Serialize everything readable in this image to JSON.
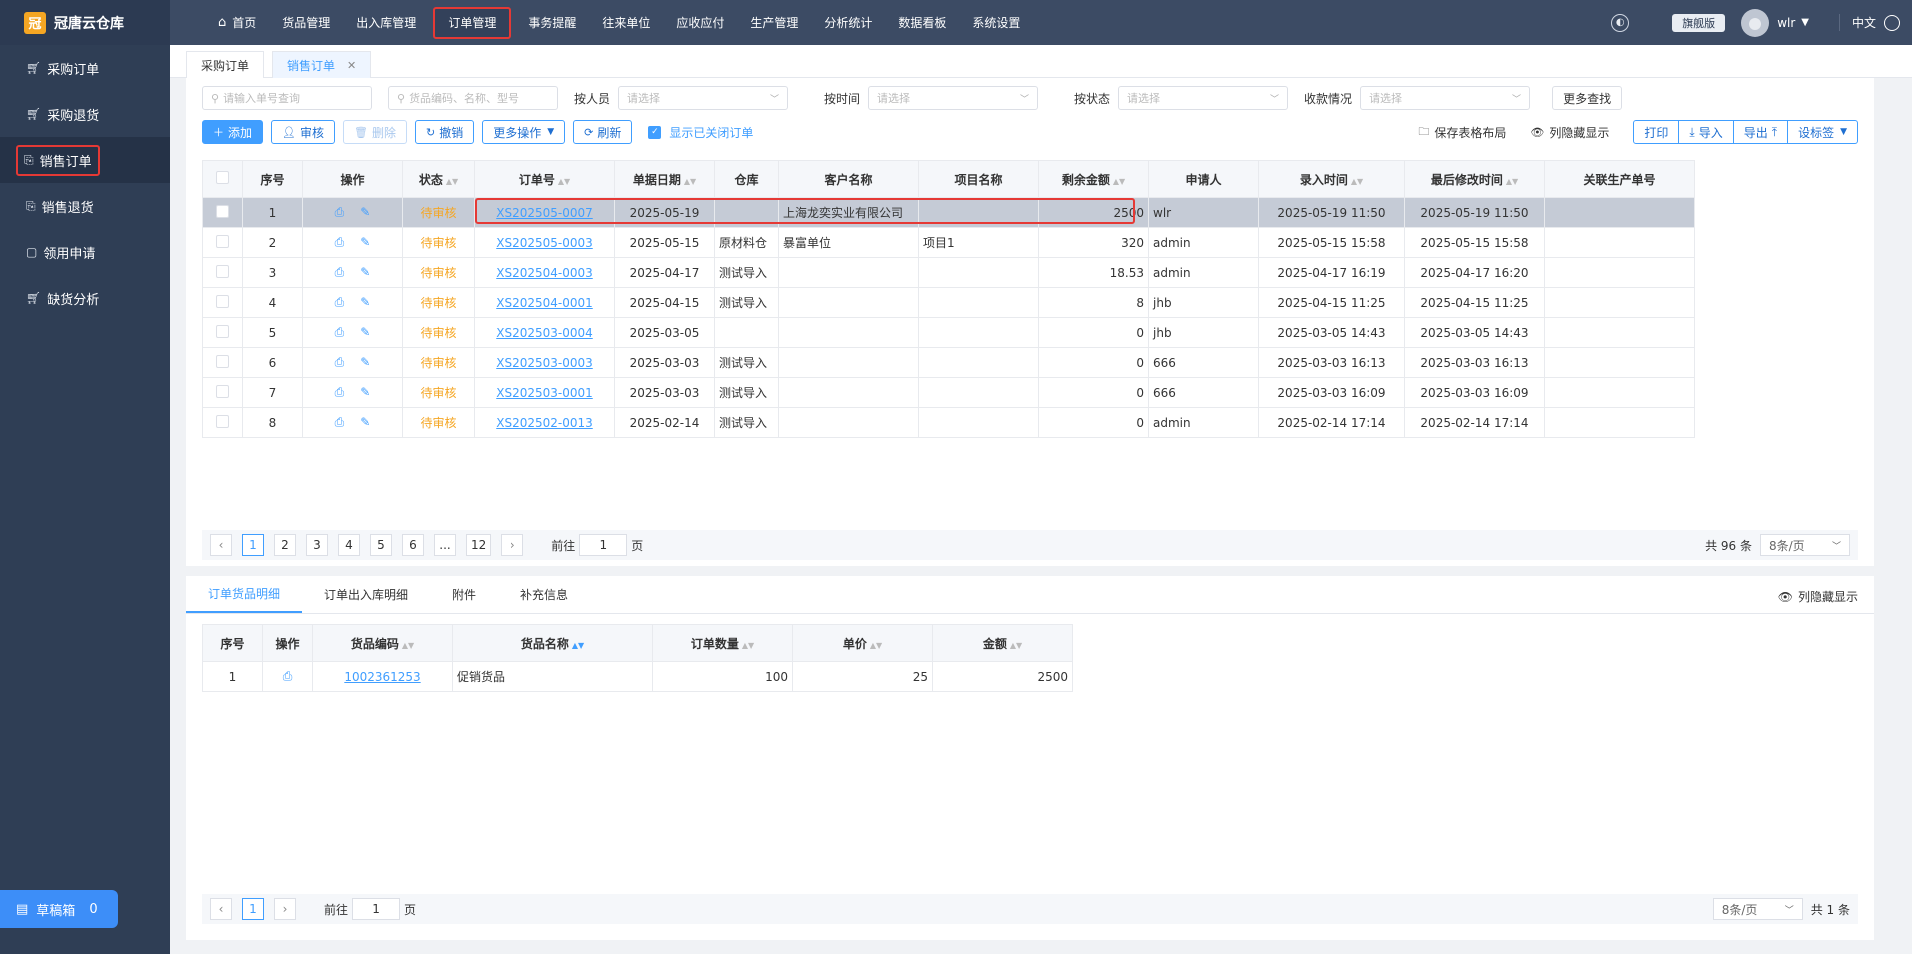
{
  "app": {
    "title": "冠唐云仓库",
    "logo_char": "冠"
  },
  "topnav": [
    {
      "label": "首页",
      "icon": "home-icon"
    },
    {
      "label": "货品管理"
    },
    {
      "label": "出入库管理"
    },
    {
      "label": "订单管理",
      "active": true
    },
    {
      "label": "事务提醒"
    },
    {
      "label": "往来单位"
    },
    {
      "label": "应收应付"
    },
    {
      "label": "生产管理"
    },
    {
      "label": "分析统计"
    },
    {
      "label": "数据看板"
    },
    {
      "label": "系统设置"
    }
  ],
  "topright": {
    "edition": "旗舰版",
    "user": "wlr",
    "lang": "中文"
  },
  "sidebar": [
    {
      "label": "采购订单",
      "icon": "cart-icon"
    },
    {
      "label": "采购退货",
      "icon": "cart-icon"
    },
    {
      "label": "销售订单",
      "icon": "bag-icon",
      "active": true
    },
    {
      "label": "销售退货",
      "icon": "bag-icon"
    },
    {
      "label": "领用申请",
      "icon": "briefcase-icon"
    },
    {
      "label": "缺货分析",
      "icon": "cart-icon"
    }
  ],
  "draft": {
    "label": "草稿箱",
    "count": "0"
  },
  "tabs": [
    {
      "label": "采购订单"
    },
    {
      "label": "销售订单",
      "active": true
    }
  ],
  "filters": {
    "order_search_placeholder": "请输入单号查询",
    "goods_search_placeholder": "货品编码、名称、型号",
    "by_person_label": "按人员",
    "by_time_label": "按时间",
    "by_status_label": "按状态",
    "payment_label": "收款情况",
    "select_placeholder": "请选择",
    "more_find": "更多查找"
  },
  "toolbar": {
    "add": "添加",
    "approve": "审核",
    "delete": "删除",
    "revoke": "撤销",
    "more_ops": "更多操作",
    "refresh": "刷新",
    "show_closed": "显示已关闭订单",
    "save_layout": "保存表格布局",
    "hide_columns": "列隐藏显示",
    "print": "打印",
    "import": "导入",
    "export": "导出",
    "set_tag": "设标签"
  },
  "orders": {
    "headers": [
      "序号",
      "操作",
      "状态",
      "订单号",
      "单据日期",
      "仓库",
      "客户名称",
      "项目名称",
      "剩余金额",
      "申请人",
      "录入时间",
      "最后修改时间",
      "关联生产单号"
    ],
    "rows": [
      {
        "no": "1",
        "status": "待审核",
        "order_no": "XS202505-0007",
        "date": "2025-05-19",
        "warehouse": "",
        "customer": "上海龙奕实业有限公司",
        "project": "",
        "amount": "2500",
        "applicant": "wlr",
        "created": "2025-05-19 11:50",
        "modified": "2025-05-19 11:50",
        "prod_no": ""
      },
      {
        "no": "2",
        "status": "待审核",
        "order_no": "XS202505-0003",
        "date": "2025-05-15",
        "warehouse": "原材料仓",
        "customer": "暴富单位",
        "project": "项目1",
        "amount": "320",
        "applicant": "admin",
        "created": "2025-05-15 15:58",
        "modified": "2025-05-15 15:58",
        "prod_no": ""
      },
      {
        "no": "3",
        "status": "待审核",
        "order_no": "XS202504-0003",
        "date": "2025-04-17",
        "warehouse": "测试导入",
        "customer": "",
        "project": "",
        "amount": "18.53",
        "applicant": "admin",
        "created": "2025-04-17 16:19",
        "modified": "2025-04-17 16:20",
        "prod_no": ""
      },
      {
        "no": "4",
        "status": "待审核",
        "order_no": "XS202504-0001",
        "date": "2025-04-15",
        "warehouse": "测试导入",
        "customer": "",
        "project": "",
        "amount": "8",
        "applicant": "jhb",
        "created": "2025-04-15 11:25",
        "modified": "2025-04-15 11:25",
        "prod_no": ""
      },
      {
        "no": "5",
        "status": "待审核",
        "order_no": "XS202503-0004",
        "date": "2025-03-05",
        "warehouse": "",
        "customer": "",
        "project": "",
        "amount": "0",
        "applicant": "jhb",
        "created": "2025-03-05 14:43",
        "modified": "2025-03-05 14:43",
        "prod_no": ""
      },
      {
        "no": "6",
        "status": "待审核",
        "order_no": "XS202503-0003",
        "date": "2025-03-03",
        "warehouse": "测试导入",
        "customer": "",
        "project": "",
        "amount": "0",
        "applicant": "666",
        "created": "2025-03-03 16:13",
        "modified": "2025-03-03 16:13",
        "prod_no": ""
      },
      {
        "no": "7",
        "status": "待审核",
        "order_no": "XS202503-0001",
        "date": "2025-03-03",
        "warehouse": "测试导入",
        "customer": "",
        "project": "",
        "amount": "0",
        "applicant": "666",
        "created": "2025-03-03 16:09",
        "modified": "2025-03-03 16:09",
        "prod_no": ""
      },
      {
        "no": "8",
        "status": "待审核",
        "order_no": "XS202502-0013",
        "date": "2025-02-14",
        "warehouse": "测试导入",
        "customer": "",
        "project": "",
        "amount": "0",
        "applicant": "admin",
        "created": "2025-02-14 17:14",
        "modified": "2025-02-14 17:14",
        "prod_no": ""
      }
    ]
  },
  "pager1": {
    "pages": [
      "1",
      "2",
      "3",
      "4",
      "5",
      "6",
      "...",
      "12"
    ],
    "goto_label": "前往",
    "goto_value": "1",
    "page_unit": "页",
    "total": "共 96 条",
    "page_size": "8条/页"
  },
  "subtabs": {
    "items": [
      "订单货品明细",
      "订单出入库明细",
      "附件",
      "补充信息"
    ],
    "hide_columns": "列隐藏显示"
  },
  "details": {
    "headers": [
      "序号",
      "操作",
      "货品编码",
      "货品名称",
      "订单数量",
      "单价",
      "金额"
    ],
    "rows": [
      {
        "no": "1",
        "code": "1002361253",
        "name": "促销货品",
        "qty": "100",
        "price": "25",
        "amount": "2500"
      }
    ]
  },
  "pager2": {
    "current": "1",
    "goto_label": "前往",
    "goto_value": "1",
    "page_unit": "页",
    "page_size": "8条/页",
    "total": "共 1 条"
  }
}
